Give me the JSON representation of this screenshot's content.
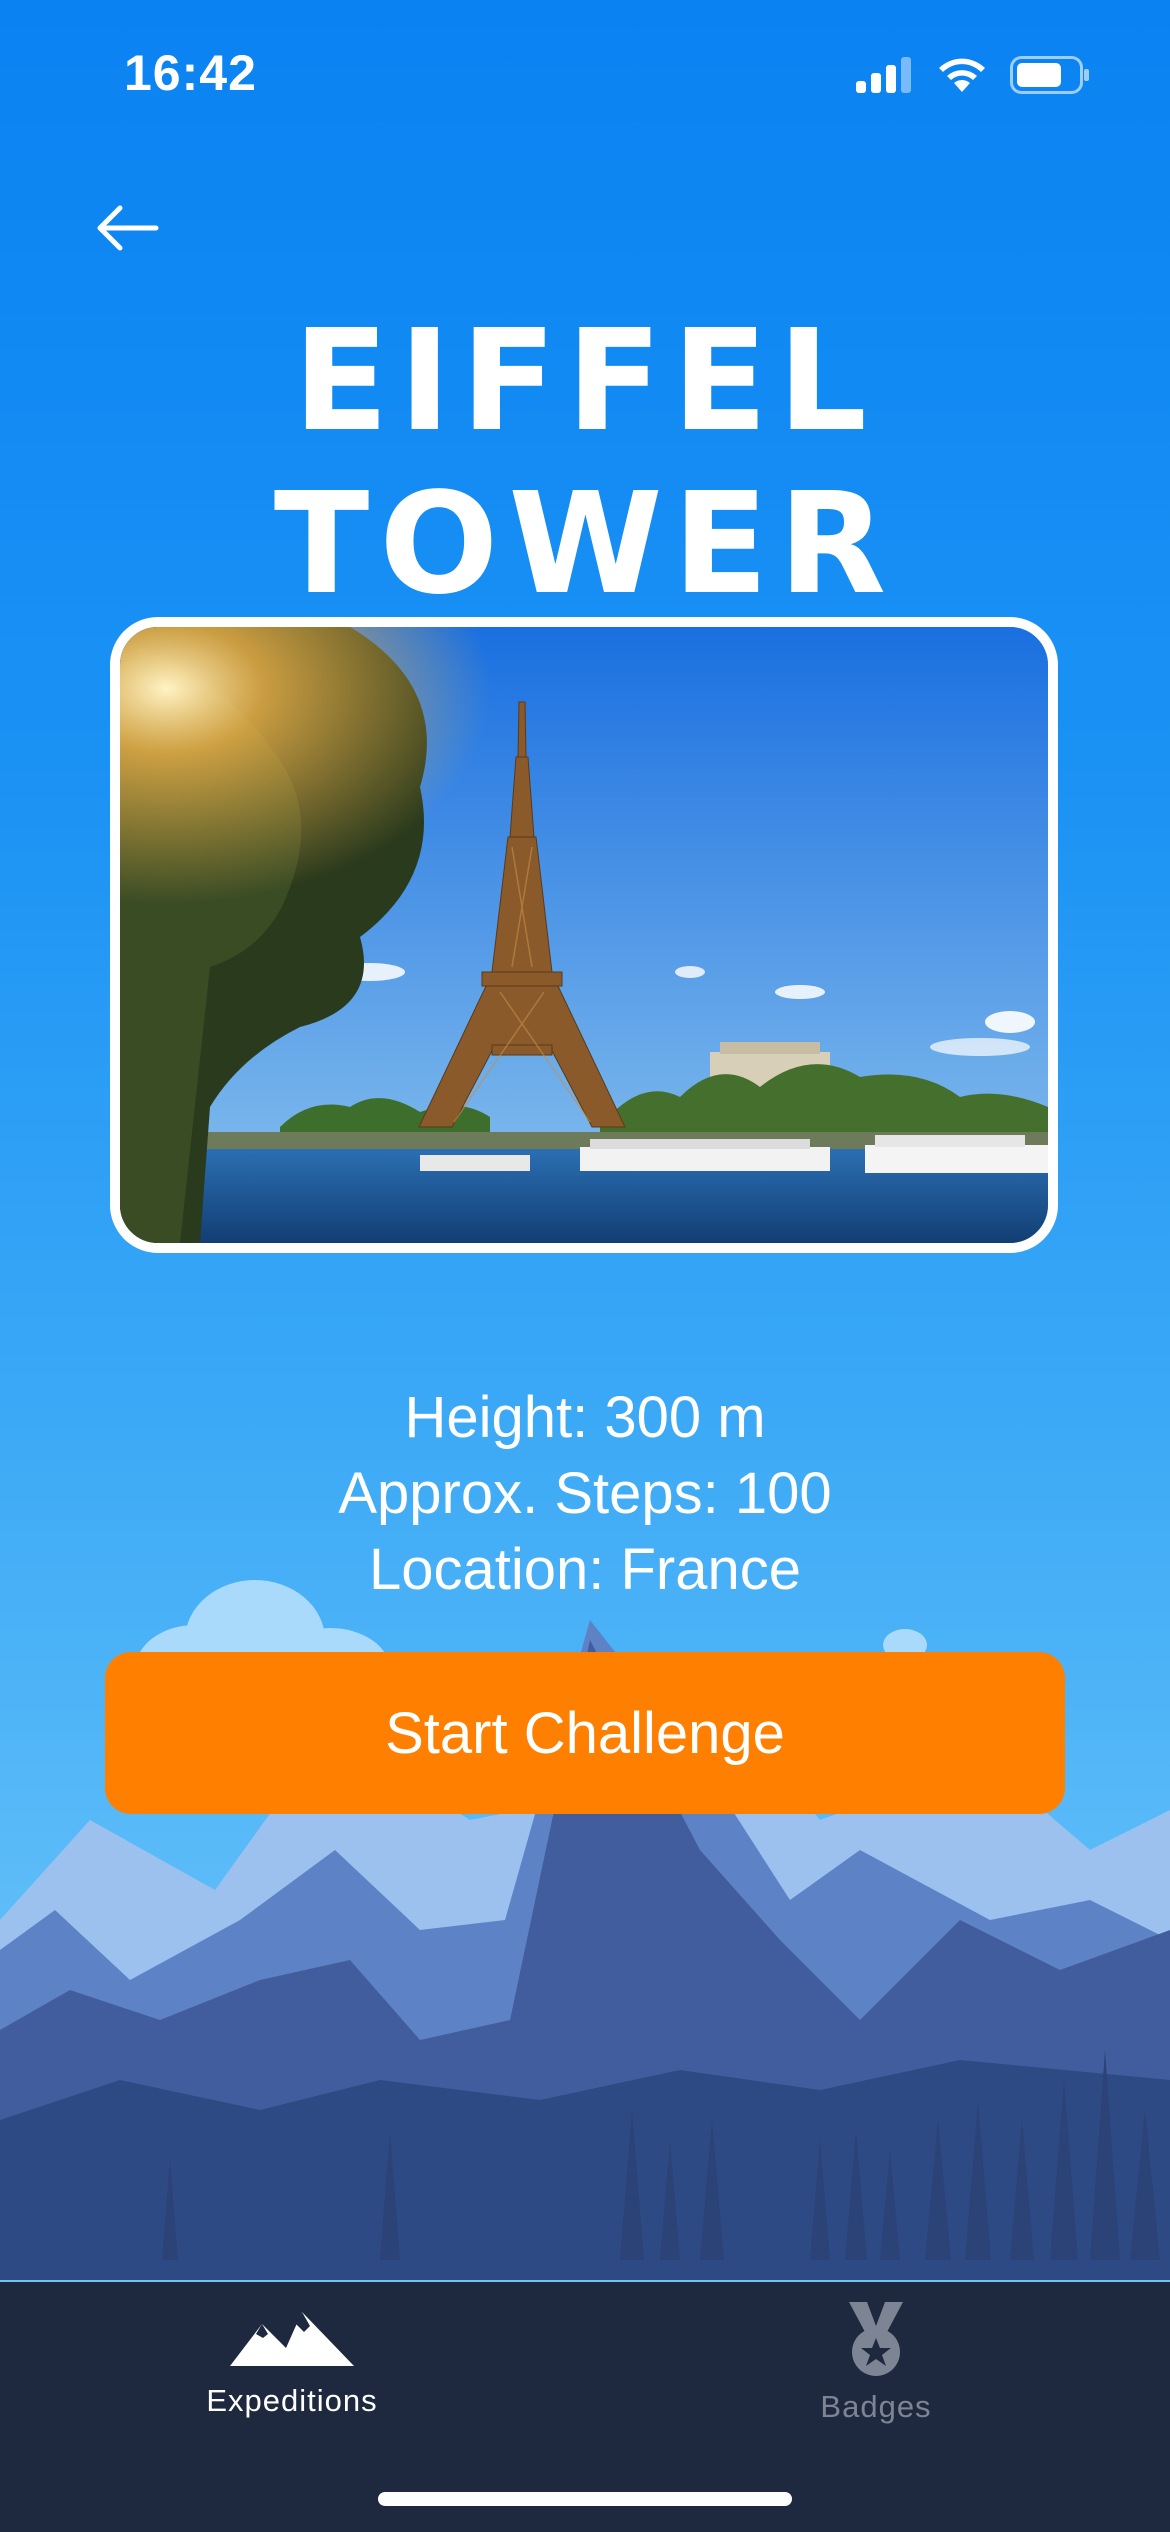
{
  "status_bar": {
    "time": "16:42"
  },
  "header": {
    "back_icon": "arrow-left-icon",
    "title": "EIFFEL TOWER"
  },
  "photo": {
    "subject": "eiffel-tower-photo"
  },
  "facts": {
    "height": "Height: 300 m",
    "steps": "Approx. Steps: 100",
    "location": "Location: France"
  },
  "actions": {
    "start_label": "Start Challenge",
    "accent_color": "#ff7f00"
  },
  "tabs": [
    {
      "label": "Expeditions",
      "icon": "mountains-icon",
      "active": true
    },
    {
      "label": "Badges",
      "icon": "medal-icon",
      "active": false
    }
  ]
}
